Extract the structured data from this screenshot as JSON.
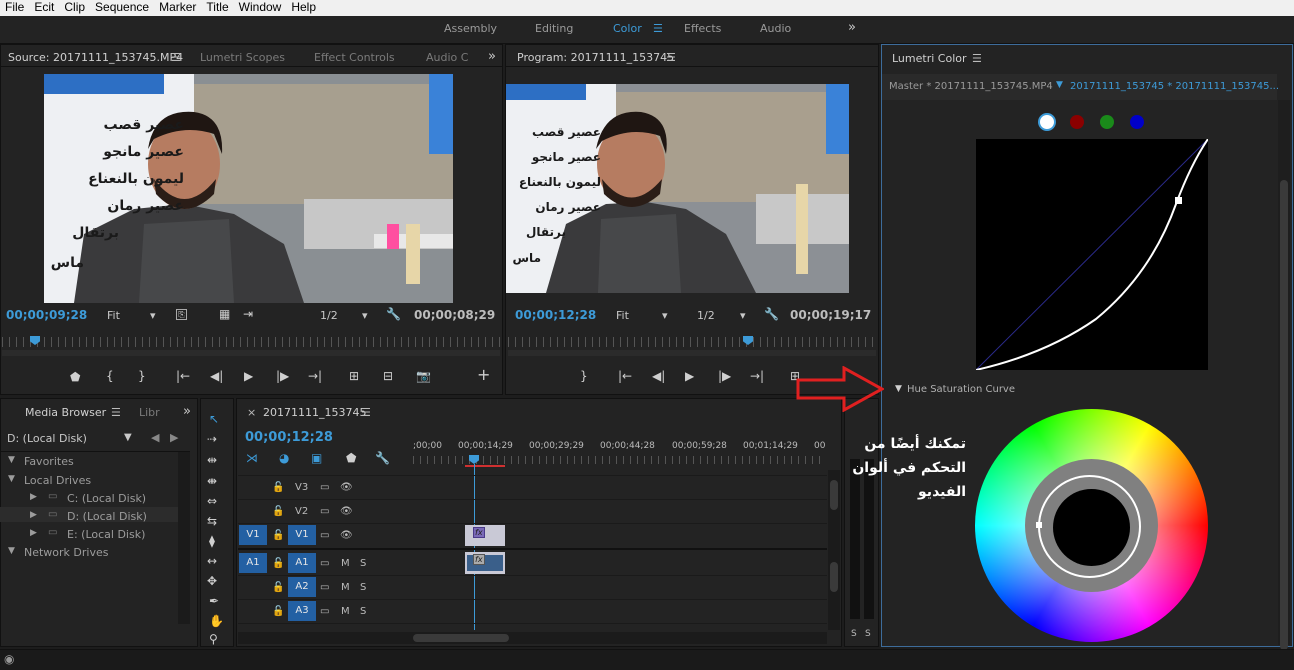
{
  "menu": [
    "File",
    "Ecit",
    "Clip",
    "Sequence",
    "Marker",
    "Title",
    "Window",
    "Help"
  ],
  "workspaces": {
    "items": [
      "Assembly",
      "Editing",
      "Color",
      "Effects",
      "Audio"
    ],
    "active": "Color",
    "overflow": "»"
  },
  "source": {
    "tabs": [
      "Source: 20171111_153745.MP4",
      "Lumetri Scopes",
      "Effect Controls",
      "Audio C"
    ],
    "timecode_in": "00;00;09;28",
    "fit": "Fit",
    "resolution": "1/2",
    "timecode_dur": "00;00;08;29"
  },
  "program": {
    "tab": "Program: 20171111_153745",
    "timecode_in": "00;00;12;28",
    "fit": "Fit",
    "resolution": "1/2",
    "timecode_dur": "00;00;19;17"
  },
  "menu_board_lines": [
    "عصير قصب",
    "عصير مانجو",
    "ليمون بالنعناع",
    "عصير رمان",
    "برتقال",
    "ماس"
  ],
  "lumetri": {
    "title": "Lumetri Color",
    "master_tab": "Master * 20171111_153745.MP4",
    "clip_tab": "20171111_153745 * 20171111_153745...",
    "curve_section": "Hue Saturation Curve",
    "channel_colors": [
      "#ffffff",
      "#8b0000",
      "#1a8a1a",
      "#0000c8"
    ]
  },
  "media_browser": {
    "tabs": [
      "Media Browser",
      "Libr"
    ],
    "drive": "D: (Local Disk)",
    "tree": [
      {
        "label": "Favorites",
        "level": 0
      },
      {
        "label": "Local Drives",
        "level": 0
      },
      {
        "label": "C: (Local Disk)",
        "level": 1
      },
      {
        "label": "D: (Local Disk)",
        "level": 1
      },
      {
        "label": "E: (Local Disk)",
        "level": 1
      },
      {
        "label": "Network Drives",
        "level": 0
      }
    ]
  },
  "timeline": {
    "tab": "20171111_153745",
    "timecode": "00;00;12;28",
    "ruler": [
      ";00;00",
      "00;00;14;29",
      "00;00;29;29",
      "00;00;44;28",
      "00;00;59;28",
      "00;01;14;29",
      "00"
    ],
    "tracks": [
      {
        "name": "V3",
        "source": "",
        "type": "v"
      },
      {
        "name": "V2",
        "source": "",
        "type": "v"
      },
      {
        "name": "V1",
        "source": "V1",
        "type": "v"
      },
      {
        "name": "A1",
        "source": "A1",
        "type": "a"
      },
      {
        "name": "A2",
        "source": "",
        "type": "a"
      },
      {
        "name": "A3",
        "source": "",
        "type": "a"
      }
    ],
    "fx_label": "fx",
    "mute": "M",
    "solo": "S"
  },
  "meter": {
    "labels": [
      "S",
      "S"
    ]
  },
  "annotation": {
    "text": "تمكنك أيضًا من التحكم في ألوان الفيديو",
    "arrow_color": "#e02020"
  }
}
